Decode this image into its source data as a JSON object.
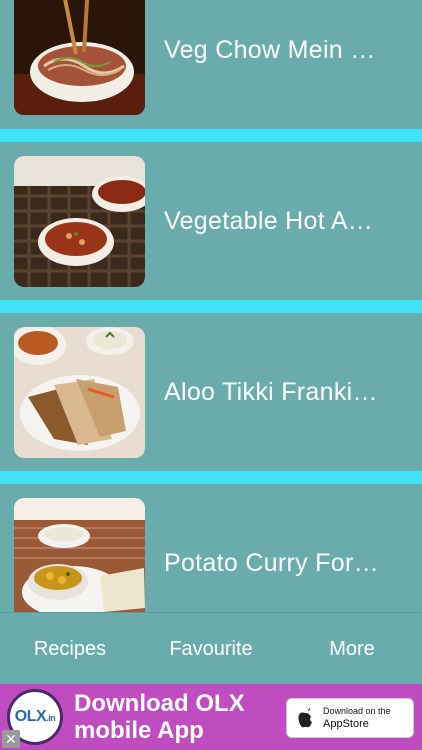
{
  "recipes": [
    {
      "title": "Veg Chow Mein Recipe",
      "image_icon": "chow-mein-photo"
    },
    {
      "title": "Vegetable Hot And Sour Soup",
      "image_icon": "soup-photo"
    },
    {
      "title": "Aloo Tikki Frankie Recipe",
      "image_icon": "frankie-photo"
    },
    {
      "title": "Potato Curry For Poori",
      "image_icon": "potato-curry-photo"
    }
  ],
  "display_titles": [
    "Veg Chow Mein …",
    "Vegetable Hot A…",
    "Aloo Tikki Franki…",
    "Potato Curry For…"
  ],
  "tabs": {
    "recipes": "Recipes",
    "favourite": "Favourite",
    "more": "More"
  },
  "ad": {
    "logo_text": "OLX",
    "logo_suffix": ".in",
    "headline_line1": "Download OLX",
    "headline_line2": "mobile App",
    "store_line1": "Download on the",
    "store_line2": "AppStore",
    "close": "✕"
  },
  "colors": {
    "background": "#6aacac",
    "separator": "#40e3f5",
    "ad_background": "#c04dbf"
  }
}
